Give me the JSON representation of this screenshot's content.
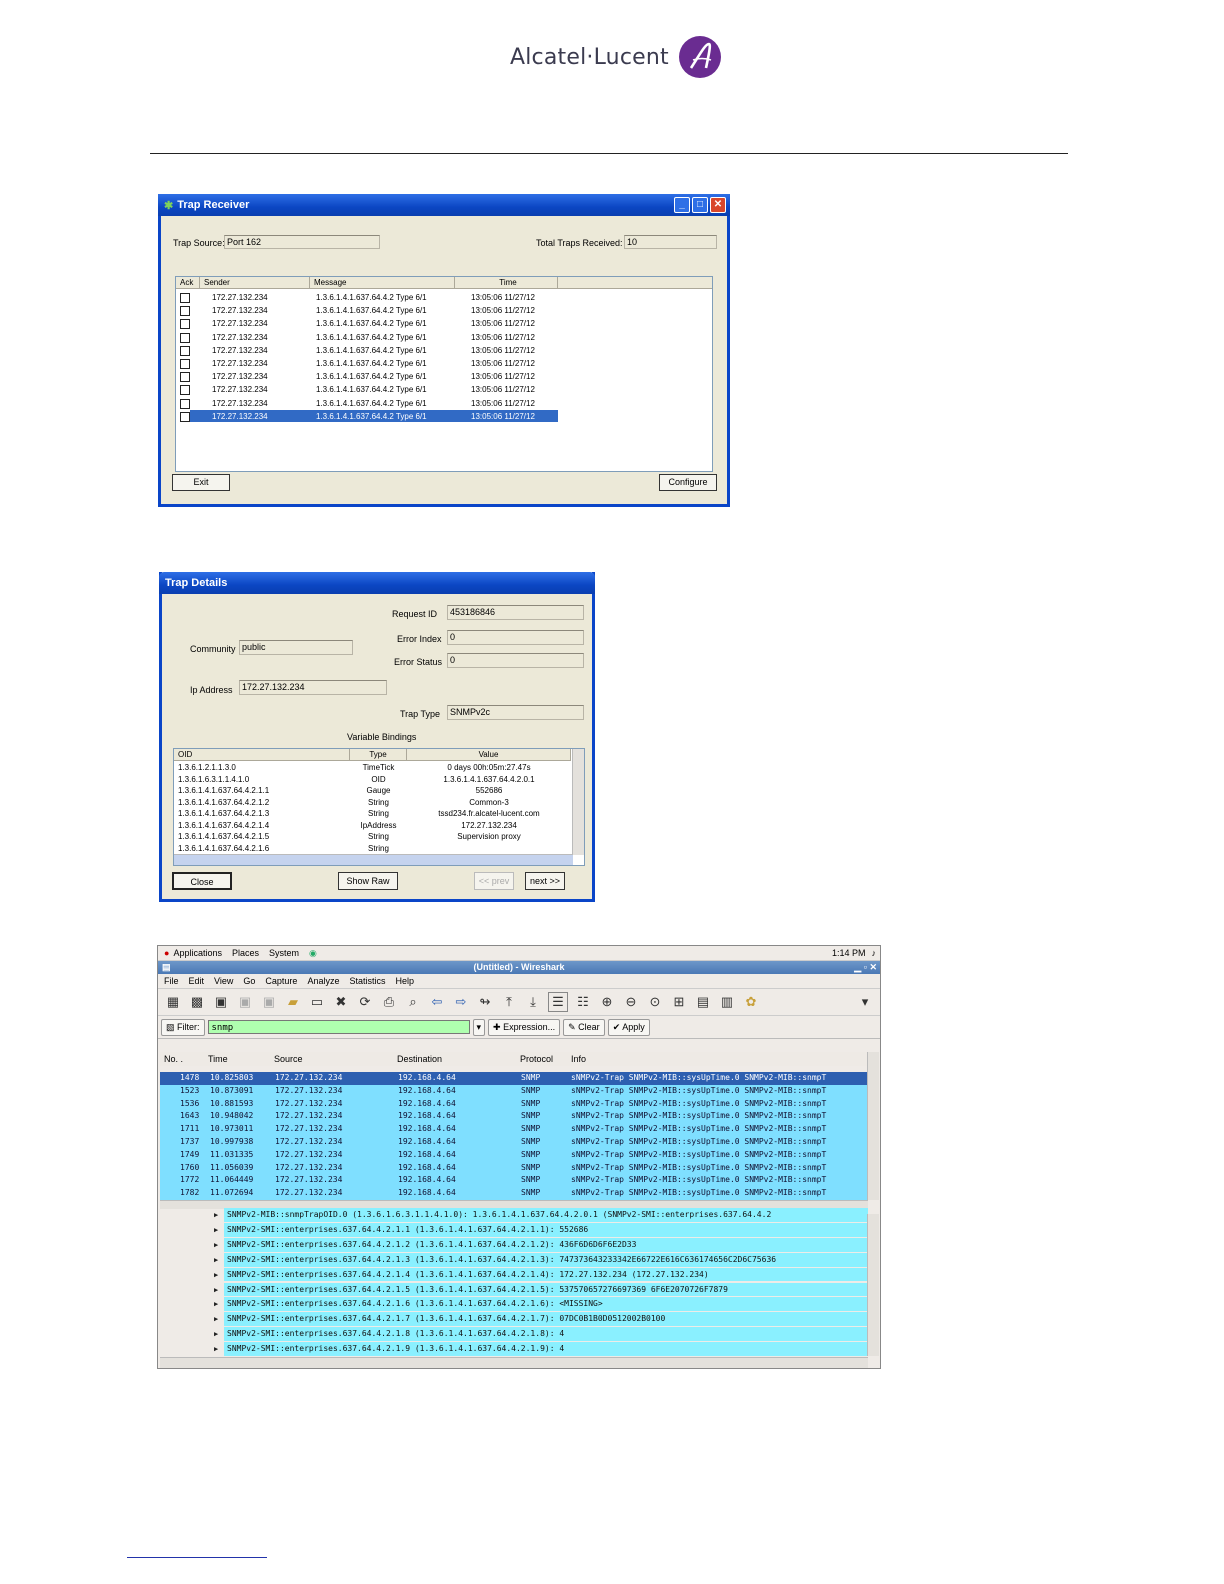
{
  "header": {
    "brand": "Alcatel·Lucent"
  },
  "trap_receiver": {
    "title": "Trap Receiver",
    "trap_source_label": "Trap Source:",
    "trap_source_value": "Port 162",
    "total_label": "Total Traps Received:",
    "total_value": "10",
    "columns": [
      "Ack",
      "Sender",
      "Message",
      "Time"
    ],
    "rows": [
      {
        "sender": "172.27.132.234",
        "message": "1.3.6.1.4.1.637.64.4.2  Type 6/1",
        "time": "13:05:06 11/27/12"
      },
      {
        "sender": "172.27.132.234",
        "message": "1.3.6.1.4.1.637.64.4.2  Type 6/1",
        "time": "13:05:06 11/27/12"
      },
      {
        "sender": "172.27.132.234",
        "message": "1.3.6.1.4.1.637.64.4.2  Type 6/1",
        "time": "13:05:06 11/27/12"
      },
      {
        "sender": "172.27.132.234",
        "message": "1.3.6.1.4.1.637.64.4.2  Type 6/1",
        "time": "13:05:06 11/27/12"
      },
      {
        "sender": "172.27.132.234",
        "message": "1.3.6.1.4.1.637.64.4.2  Type 6/1",
        "time": "13:05:06 11/27/12"
      },
      {
        "sender": "172.27.132.234",
        "message": "1.3.6.1.4.1.637.64.4.2  Type 6/1",
        "time": "13:05:06 11/27/12"
      },
      {
        "sender": "172.27.132.234",
        "message": "1.3.6.1.4.1.637.64.4.2  Type 6/1",
        "time": "13:05:06 11/27/12"
      },
      {
        "sender": "172.27.132.234",
        "message": "1.3.6.1.4.1.637.64.4.2  Type 6/1",
        "time": "13:05:06 11/27/12"
      },
      {
        "sender": "172.27.132.234",
        "message": "1.3.6.1.4.1.637.64.4.2  Type 6/1",
        "time": "13:05:06 11/27/12"
      },
      {
        "sender": "172.27.132.234",
        "message": "1.3.6.1.4.1.637.64.4.2  Type 6/1",
        "time": "13:05:06 11/27/12"
      }
    ],
    "selected_row": 9,
    "exit_label": "Exit",
    "configure_label": "Configure"
  },
  "trap_details": {
    "title": "Trap Details",
    "request_id_label": "Request ID",
    "request_id_value": "453186846",
    "community_label": "Community",
    "community_value": "public",
    "error_index_label": "Error Index",
    "error_index_value": "0",
    "error_status_label": "Error Status",
    "error_status_value": "0",
    "ip_label": "Ip Address",
    "ip_value": "172.27.132.234",
    "trap_type_label": "Trap Type",
    "trap_type_value": "SNMPv2c",
    "bindings_label": "Variable Bindings",
    "columns": [
      "OID",
      "Type",
      "Value"
    ],
    "rows": [
      {
        "oid": "1.3.6.1.2.1.1.3.0",
        "type": "TimeTick",
        "value": "0 days 00h:05m:27.47s"
      },
      {
        "oid": "1.3.6.1.6.3.1.1.4.1.0",
        "type": "OID",
        "value": "1.3.6.1.4.1.637.64.4.2.0.1"
      },
      {
        "oid": "1.3.6.1.4.1.637.64.4.2.1.1",
        "type": "Gauge",
        "value": "552686"
      },
      {
        "oid": "1.3.6.1.4.1.637.64.4.2.1.2",
        "type": "String",
        "value": "Common-3"
      },
      {
        "oid": "1.3.6.1.4.1.637.64.4.2.1.3",
        "type": "String",
        "value": "tssd234.fr.alcatel-lucent.com"
      },
      {
        "oid": "1.3.6.1.4.1.637.64.4.2.1.4",
        "type": "IpAddress",
        "value": "172.27.132.234"
      },
      {
        "oid": "1.3.6.1.4.1.637.64.4.2.1.5",
        "type": "String",
        "value": "Supervision proxy"
      },
      {
        "oid": "1.3.6.1.4.1.637.64.4.2.1.6",
        "type": "String",
        "value": ""
      }
    ],
    "close_label": "Close",
    "show_raw_label": "Show Raw",
    "prev_label": "<< prev",
    "next_label": "next >>"
  },
  "wireshark": {
    "gnome_apps": "Applications",
    "gnome_places": "Places",
    "gnome_system": "System",
    "clock": "1:14 PM",
    "title": "(Untitled) - Wireshark",
    "menu": [
      "File",
      "Edit",
      "View",
      "Go",
      "Capture",
      "Analyze",
      "Statistics",
      "Help"
    ],
    "filter_label": "Filter:",
    "filter_value": "snmp",
    "expression_label": "Expression...",
    "clear_label": "Clear",
    "apply_label": "Apply",
    "columns": [
      "No. .",
      "Time",
      "Source",
      "Destination",
      "Protocol",
      "Info"
    ],
    "packets": [
      {
        "no": "1478",
        "time": "10.825803",
        "src": "172.27.132.234",
        "dst": "192.168.4.64",
        "proto": "SNMP",
        "info": "sNMPv2-Trap SNMPv2-MIB::sysUpTime.0 SNMPv2-MIB::snmpT"
      },
      {
        "no": "1523",
        "time": "10.873091",
        "src": "172.27.132.234",
        "dst": "192.168.4.64",
        "proto": "SNMP",
        "info": "sNMPv2-Trap SNMPv2-MIB::sysUpTime.0 SNMPv2-MIB::snmpT"
      },
      {
        "no": "1536",
        "time": "10.881593",
        "src": "172.27.132.234",
        "dst": "192.168.4.64",
        "proto": "SNMP",
        "info": "sNMPv2-Trap SNMPv2-MIB::sysUpTime.0 SNMPv2-MIB::snmpT"
      },
      {
        "no": "1643",
        "time": "10.948042",
        "src": "172.27.132.234",
        "dst": "192.168.4.64",
        "proto": "SNMP",
        "info": "sNMPv2-Trap SNMPv2-MIB::sysUpTime.0 SNMPv2-MIB::snmpT"
      },
      {
        "no": "1711",
        "time": "10.973011",
        "src": "172.27.132.234",
        "dst": "192.168.4.64",
        "proto": "SNMP",
        "info": "sNMPv2-Trap SNMPv2-MIB::sysUpTime.0 SNMPv2-MIB::snmpT"
      },
      {
        "no": "1737",
        "time": "10.997938",
        "src": "172.27.132.234",
        "dst": "192.168.4.64",
        "proto": "SNMP",
        "info": "sNMPv2-Trap SNMPv2-MIB::sysUpTime.0 SNMPv2-MIB::snmpT"
      },
      {
        "no": "1749",
        "time": "11.031335",
        "src": "172.27.132.234",
        "dst": "192.168.4.64",
        "proto": "SNMP",
        "info": "sNMPv2-Trap SNMPv2-MIB::sysUpTime.0 SNMPv2-MIB::snmpT"
      },
      {
        "no": "1760",
        "time": "11.056039",
        "src": "172.27.132.234",
        "dst": "192.168.4.64",
        "proto": "SNMP",
        "info": "sNMPv2-Trap SNMPv2-MIB::sysUpTime.0 SNMPv2-MIB::snmpT"
      },
      {
        "no": "1772",
        "time": "11.064449",
        "src": "172.27.132.234",
        "dst": "192.168.4.64",
        "proto": "SNMP",
        "info": "sNMPv2-Trap SNMPv2-MIB::sysUpTime.0 SNMPv2-MIB::snmpT"
      },
      {
        "no": "1782",
        "time": "11.072694",
        "src": "172.27.132.234",
        "dst": "192.168.4.64",
        "proto": "SNMP",
        "info": "sNMPv2-Trap SNMPv2-MIB::sysUpTime.0 SNMPv2-MIB::snmpT"
      }
    ],
    "details": [
      "SNMPv2-MIB::snmpTrapOID.0 (1.3.6.1.6.3.1.1.4.1.0): 1.3.6.1.4.1.637.64.4.2.0.1 (SNMPv2-SMI::enterprises.637.64.4.2",
      "SNMPv2-SMI::enterprises.637.64.4.2.1.1 (1.3.6.1.4.1.637.64.4.2.1.1): 552686",
      "SNMPv2-SMI::enterprises.637.64.4.2.1.2 (1.3.6.1.4.1.637.64.4.2.1.2): 436F6D6D6F6E2D33",
      "SNMPv2-SMI::enterprises.637.64.4.2.1.3 (1.3.6.1.4.1.637.64.4.2.1.3): 747373643233342E66722E616C636174656C2D6C75636",
      "SNMPv2-SMI::enterprises.637.64.4.2.1.4 (1.3.6.1.4.1.637.64.4.2.1.4): 172.27.132.234 (172.27.132.234)",
      "SNMPv2-SMI::enterprises.637.64.4.2.1.5 (1.3.6.1.4.1.637.64.4.2.1.5): 537570657276697369 6F6E2070726F7879",
      "SNMPv2-SMI::enterprises.637.64.4.2.1.6 (1.3.6.1.4.1.637.64.4.2.1.6): <MISSING>",
      "SNMPv2-SMI::enterprises.637.64.4.2.1.7 (1.3.6.1.4.1.637.64.4.2.1.7): 07DC0B1B0D0512002B0100",
      "SNMPv2-SMI::enterprises.637.64.4.2.1.8 (1.3.6.1.4.1.637.64.4.2.1.8): 4",
      "SNMPv2-SMI::enterprises.637.64.4.2.1.9 (1.3.6.1.4.1.637.64.4.2.1.9): 4"
    ]
  }
}
